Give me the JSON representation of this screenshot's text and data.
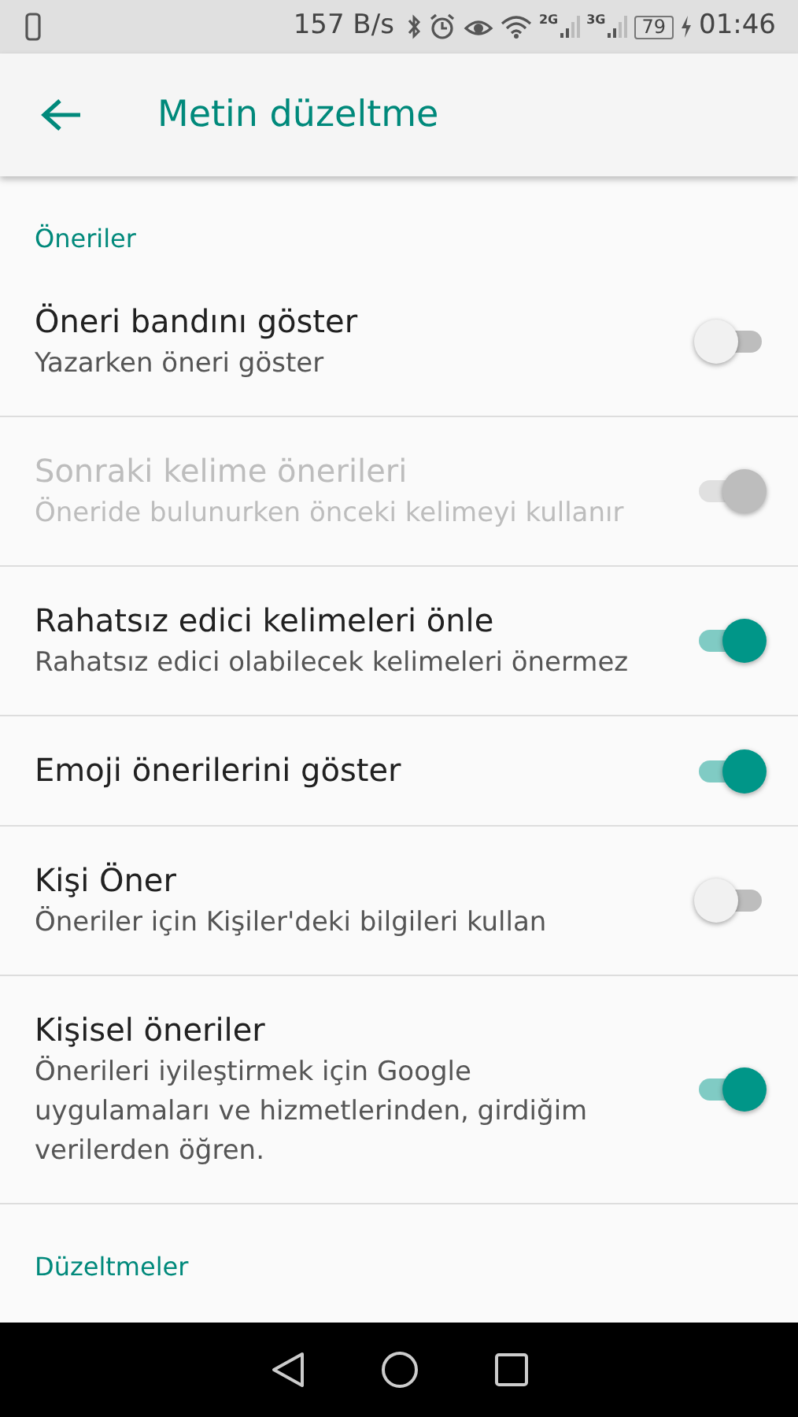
{
  "status_bar": {
    "speed": "157 B/s",
    "sim1": "2G",
    "sim2": "3G",
    "battery": "79",
    "time": "01:46"
  },
  "app_bar": {
    "title": "Metin düzeltme"
  },
  "sections": [
    {
      "header": "Öneriler",
      "items": [
        {
          "title": "Öneri bandını göster",
          "subtitle": "Yazarken öneri göster",
          "on": false,
          "disabled": false
        },
        {
          "title": "Sonraki kelime önerileri",
          "subtitle": "Öneride bulunurken önceki kelimeyi kullanır",
          "on": true,
          "disabled": true
        },
        {
          "title": "Rahatsız edici kelimeleri önle",
          "subtitle": "Rahatsız edici olabilecek kelimeleri önermez",
          "on": true,
          "disabled": false
        },
        {
          "title": "Emoji önerilerini göster",
          "on": true,
          "disabled": false
        },
        {
          "title": "Kişi Öner",
          "subtitle": "Öneriler için Kişiler'deki bilgileri kullan",
          "on": false,
          "disabled": false
        },
        {
          "title": "Kişisel öneriler",
          "subtitle": "Önerileri iyileştirmek için Google uygulamaları ve hizmetlerinden, girdiğim verilerden öğren.",
          "on": true,
          "disabled": false
        }
      ]
    },
    {
      "header": "Düzeltmeler"
    }
  ]
}
